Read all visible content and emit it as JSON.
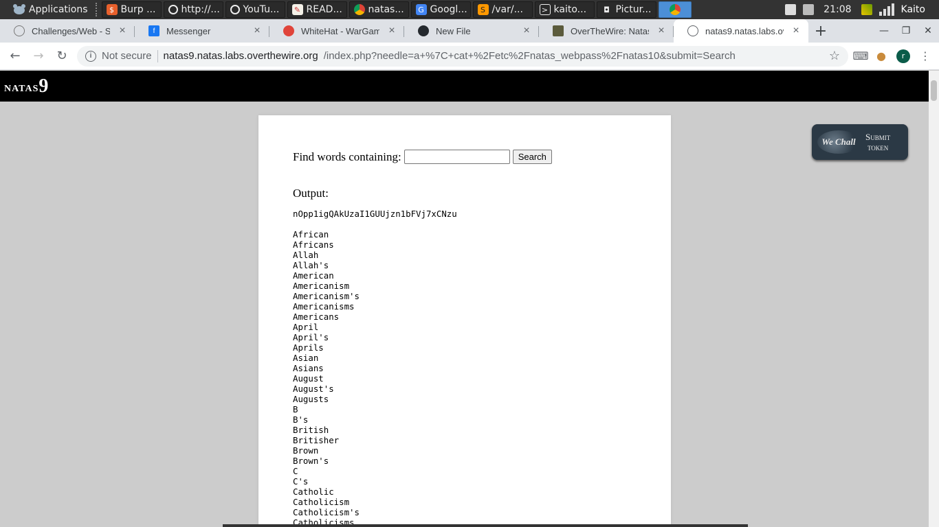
{
  "os_panel": {
    "applications_label": "Applications",
    "tasks": [
      {
        "label": "Burp ...",
        "icon": "burp-icon"
      },
      {
        "label": "http://...",
        "icon": "clock-icon"
      },
      {
        "label": "YouTu...",
        "icon": "clock-icon"
      },
      {
        "label": "READ...",
        "icon": "notepad-icon"
      },
      {
        "label": "natas...",
        "icon": "chrome-icon"
      },
      {
        "label": "Googl...",
        "icon": "google-translate-icon"
      },
      {
        "label": "/var/...",
        "icon": "sublime-icon"
      },
      {
        "label": "kaito...",
        "icon": "terminal-icon"
      },
      {
        "label": "Pictur...",
        "icon": "camera-icon"
      }
    ],
    "clock": "21:08",
    "user": "Kaito"
  },
  "tabs": [
    {
      "label": "Challenges/Web - Se",
      "icon": "root-me-icon"
    },
    {
      "label": "Messenger",
      "icon": "facebook-icon"
    },
    {
      "label": "WhiteHat - WarGam",
      "icon": "whitehat-icon"
    },
    {
      "label": "New File",
      "icon": "github-icon"
    },
    {
      "label": "OverTheWire: Natas",
      "icon": "overthewire-icon"
    },
    {
      "label": "natas9.natas.labs.ov",
      "icon": "globe-icon"
    }
  ],
  "address_bar": {
    "security": "Not secure",
    "host": "natas9.natas.labs.overthewire.org",
    "path": "/index.php?needle=a+%7C+cat+%2Fetc%2Fnatas_webpass%2Fnatas10&submit=Search",
    "avatar_letter": "r"
  },
  "page": {
    "header_small": "natas",
    "header_number": "9",
    "find_label": "Find words containing:",
    "search_button": "Search",
    "output_label": "Output:",
    "output_text": "nOpp1igQAkUzaI1GUUjzn1bFVj7xCNzu\n\nAfrican\nAfricans\nAllah\nAllah's\nAmerican\nAmericanism\nAmericanism's\nAmericanisms\nAmericans\nApril\nApril's\nAprils\nAsian\nAsians\nAugust\nAugust's\nAugusts\nB\nB's\nBritish\nBritisher\nBrown\nBrown's\nC\nC's\nCatholic\nCatholicism\nCatholicism's\nCatholicisms",
    "wechall_logo": "We Chall",
    "wechall_line1": "Submit",
    "wechall_line2": "token"
  }
}
